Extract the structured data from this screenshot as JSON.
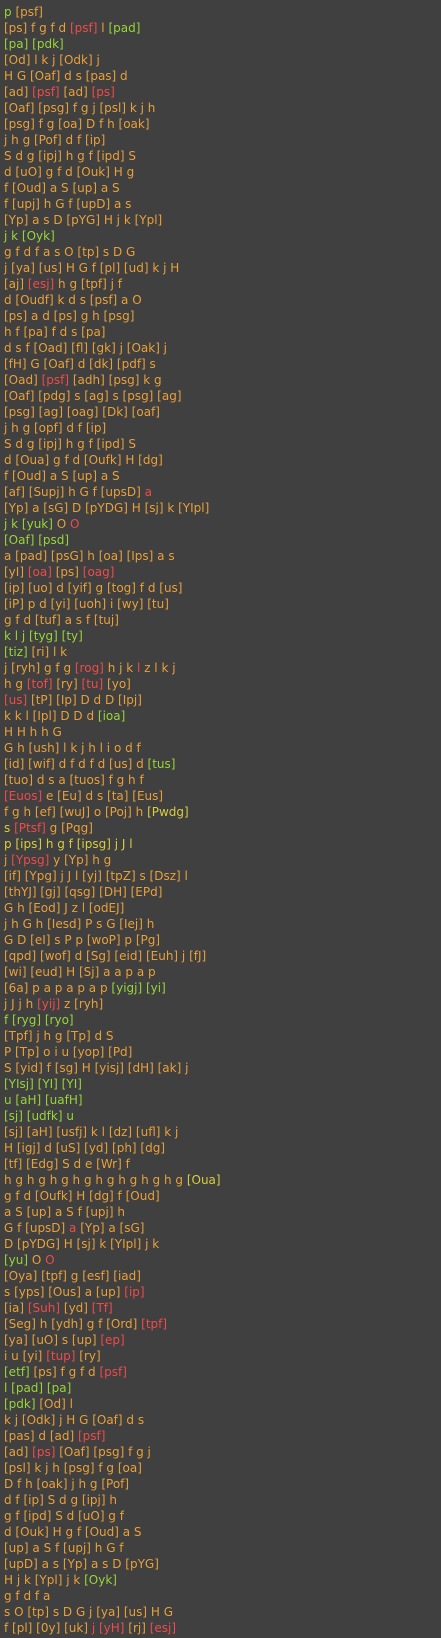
{
  "colors": {
    "background": "#404040",
    "orange": "#e8a03a",
    "green": "#98d43a",
    "red": "#ee4b4b",
    "yellow": "#d8cd3f"
  },
  "lines": [
    [
      [
        "G",
        "p "
      ],
      [
        "O",
        "[psf]"
      ]
    ],
    [
      [
        "O",
        "[ps] f g f d "
      ],
      [
        "R",
        "[psf]"
      ],
      [
        "O",
        " l "
      ],
      [
        "G",
        "[pad]"
      ]
    ],
    [
      [
        "G",
        "[pa] [pdk]"
      ]
    ],
    [
      [
        "O",
        "[Od] l k j [Odk] j"
      ]
    ],
    [
      [
        "O",
        "H G [Oaf] d s [pas] d"
      ]
    ],
    [
      [
        "O",
        "[ad] "
      ],
      [
        "R",
        "[psf]"
      ],
      [
        "O",
        " [ad] "
      ],
      [
        "R",
        "[ps]"
      ]
    ],
    [
      [
        "O",
        "[Oaf] [psg] f g j [psl] k j h"
      ]
    ],
    [
      [
        "O",
        "[psg] f g [oa] D f h [oak]"
      ]
    ],
    [
      [
        "O",
        "j h g [Pof] d f [ip]"
      ]
    ],
    [
      [
        "O",
        "S d g [ipj] h g f [ipd] S"
      ]
    ],
    [
      [
        "O",
        "d [uO] g f d [Ouk] H g"
      ]
    ],
    [
      [
        "O",
        "f [Oud] a S [up] a S"
      ]
    ],
    [
      [
        "O",
        "f [upj] h G f [upD] a s"
      ]
    ],
    [
      [
        "O",
        "[Yp] a s D [pYG] H j k [Ypl]"
      ]
    ],
    [
      [
        "G",
        "j k [Oyk]"
      ]
    ],
    [
      [
        "O",
        "g f d f a s O [tp] s D G"
      ]
    ],
    [
      [
        "O",
        "j [ya] [us] H G f [pl] [ud] k j H"
      ]
    ],
    [
      [
        "O",
        "[aj] "
      ],
      [
        "R",
        "[esj]"
      ],
      [
        "O",
        " h g [tpf] j f"
      ]
    ],
    [
      [
        "O",
        "d [Oudf] k d s [psf] a O"
      ]
    ],
    [
      [
        "O",
        "[ps] a d [ps] g h [psg]"
      ]
    ],
    [
      [
        "O",
        "h f [pa] f d s [pa]"
      ]
    ],
    [
      [
        "O",
        "d s f [Oad] [fl] [gk] j [Oak] j"
      ]
    ],
    [
      [
        "O",
        "[fH] G [Oaf] d [dk] [pdf] s"
      ]
    ],
    [
      [
        "O",
        "[Oad] "
      ],
      [
        "R",
        "[psf]"
      ],
      [
        "O",
        " [adh] [psg] k g"
      ]
    ],
    [
      [
        "O",
        "[Oaf] [pdg] s [ag] s [psg] [ag]"
      ]
    ],
    [
      [
        "O",
        "[psg] [ag] [oag] [Dk] [oaf]"
      ]
    ],
    [
      [
        "O",
        "j h g [opf] d f [ip]"
      ]
    ],
    [
      [
        "O",
        "S d g [ipj] h g f [ipd] S"
      ]
    ],
    [
      [
        "O",
        "d [Oua] g f d [Oufk] H [dg]"
      ]
    ],
    [
      [
        "O",
        "f [Oud] a S [up] a S"
      ]
    ],
    [
      [
        "O",
        "[af] [Supj] h G f [upsD] "
      ],
      [
        "R",
        "a"
      ]
    ],
    [
      [
        "O",
        "[Yp] a [sG] D [pYDG] H [sj] k [YIpl]"
      ]
    ],
    [
      [
        "G",
        "j k [yuk] "
      ],
      [
        "O",
        "O "
      ],
      [
        "R",
        "O"
      ]
    ],
    [
      [
        "G",
        "[Oaf] [psd]"
      ]
    ],
    [
      [
        "O",
        "a [pad] [psG] h [oa] [Ips] a s"
      ]
    ],
    [
      [
        "O",
        "[yI] "
      ],
      [
        "R",
        "[oa]"
      ],
      [
        "O",
        " [ps] "
      ],
      [
        "R",
        "[oag]"
      ]
    ],
    [
      [
        "O",
        "[ip] [uo] d [yif] g [tog] f d [us]"
      ]
    ],
    [
      [
        "O",
        "[iP] p d [yi] [uoh] i [wy] [tu]"
      ]
    ],
    [
      [
        "O",
        "g f d [tuf] a s f [tuj]"
      ]
    ],
    [
      [
        "G",
        "k l j [tyg] [ty]"
      ]
    ],
    [
      [
        "G",
        "[tiz] "
      ],
      [
        "O",
        "[ri] l k"
      ]
    ],
    [
      [
        "O",
        "j [ryh] g f g "
      ],
      [
        "R",
        "[rog]"
      ],
      [
        "O",
        " h j k "
      ],
      [
        "R",
        "l"
      ],
      [
        "O",
        " z l k j"
      ]
    ],
    [
      [
        "O",
        "h g "
      ],
      [
        "R",
        "[tof]"
      ],
      [
        "O",
        " [ry] "
      ],
      [
        "R",
        "[tu]"
      ],
      [
        "O",
        " [yo]"
      ]
    ],
    [
      [
        "R",
        "[us]"
      ],
      [
        "O",
        " [tP] [Ip] D d D [Ipj]"
      ]
    ],
    [
      [
        "O",
        "k k l [Ipl] D D d "
      ],
      [
        "G",
        "[ioa]"
      ]
    ],
    [
      [
        "O",
        "H H h h G"
      ]
    ],
    [
      [
        "O",
        "G h [ush] l k j h l i o d f"
      ]
    ],
    [
      [
        "O",
        "[id] [wif] d f d f d [us] d "
      ],
      [
        "G",
        "[tus]"
      ]
    ],
    [
      [
        "O",
        "[tuo] d s a [tuos] f g h f"
      ]
    ],
    [
      [
        "R",
        "[Euos]"
      ],
      [
        "O",
        " e [Eu] d s [ta] [Eus]"
      ]
    ],
    [
      [
        "O",
        "f g h [ef] [wuJ] o [Poj] h "
      ],
      [
        "Y",
        "[Pwdg]"
      ]
    ],
    [
      [
        "Y",
        "s "
      ],
      [
        "R",
        "[Ptsf]"
      ],
      [
        "O",
        " g [Pqg]"
      ]
    ],
    [
      [
        "Y",
        "p [ips] h g f [ipsg] j J l"
      ]
    ],
    [
      [
        "O",
        "j "
      ],
      [
        "R",
        "[Ypsg]"
      ],
      [
        "O",
        " y [Yp] h g"
      ]
    ],
    [
      [
        "O",
        "[if] [Ypg] j J l [yj] [tpZ] s [Dsz] l"
      ]
    ],
    [
      [
        "O",
        "[thYJ] [gj] [qsg] [DH] [EPd]"
      ]
    ],
    [
      [
        "O",
        "G h [Eod] J z l [odEJ]"
      ]
    ],
    [
      [
        "O",
        "j h G h [Iesd] P s G [Iej] h"
      ]
    ],
    [
      [
        "O",
        "G D [eI] s P p [woP] p [Pg]"
      ]
    ],
    [
      [
        "O",
        "[qpd] [wof] d [Sg] [eid] [Euh] j [fJ]"
      ]
    ],
    [
      [
        "O",
        "[wi] [eud] H [Sj] a a p a p"
      ]
    ],
    [
      [
        "O",
        "[6a] p a p a p a p "
      ],
      [
        "G",
        "[yigj] [yi]"
      ]
    ],
    [
      [
        "O",
        "j J j h "
      ],
      [
        "R",
        "[yij]"
      ],
      [
        "O",
        " z [ryh]"
      ]
    ],
    [
      [
        "G",
        "f [ryg] [ryo]"
      ]
    ],
    [
      [
        "O",
        "[Tpf] j h g [Tp] d S"
      ]
    ],
    [
      [
        "O",
        "P [Tp] o i u [yop] [Pd]"
      ]
    ],
    [
      [
        "O",
        "S [yid] f [sg] H [yisj] [dH] [ak] j"
      ]
    ],
    [
      [
        "G",
        "[YIsj] [YI] [YI]"
      ]
    ],
    [
      [
        "G",
        "u [aH] [uafH]"
      ]
    ],
    [
      [
        "G",
        "[sj] [udfk] u"
      ]
    ],
    [
      [
        "O",
        "[sj] [aH] [usfj] k l [dz] [ufl] k j"
      ]
    ],
    [
      [
        "O",
        "H [igj] d [uS] [yd] [ph] [dg]"
      ]
    ],
    [
      [
        "O",
        "[tf] [Edg] S d e [Wr] f"
      ]
    ],
    [
      [
        "O",
        "h g h g h g h g h g h g h g h g "
      ],
      [
        "Y",
        "[Oua]"
      ]
    ],
    [
      [
        "O",
        "g f d [Oufk] H [dg] f [Oud]"
      ]
    ],
    [
      [
        "O",
        "a S [up] a S f [upj] h"
      ]
    ],
    [
      [
        "O",
        "G f [upsD] "
      ],
      [
        "R",
        "a"
      ],
      [
        "O",
        " [Yp] a [sG]"
      ]
    ],
    [
      [
        "O",
        "D [pYDG] H [sj] k [YIpl] j k"
      ]
    ],
    [
      [
        "G",
        "[yu] "
      ],
      [
        "O",
        "O "
      ],
      [
        "R",
        "O"
      ]
    ],
    [
      [
        "O",
        "[Oya] [tpf] g [esf] [iad]"
      ]
    ],
    [
      [
        "O",
        "s [yps] [Ous] a [up] "
      ],
      [
        "R",
        "[ip]"
      ]
    ],
    [
      [
        "O",
        "[ia] "
      ],
      [
        "R",
        "[Suh]"
      ],
      [
        "O",
        " [yd] "
      ],
      [
        "R",
        "[Tf]"
      ]
    ],
    [
      [
        "O",
        "[Seg] h [ydh] g f [Ord] "
      ],
      [
        "R",
        "[tpf]"
      ]
    ],
    [
      [
        "O",
        "[ya] [uO] s [up] "
      ],
      [
        "R",
        "[ep]"
      ]
    ],
    [
      [
        "O",
        "i u [yi] "
      ],
      [
        "R",
        "[tup]"
      ],
      [
        "O",
        " [ry]"
      ]
    ],
    [
      [
        "G",
        "[etf] "
      ],
      [
        "O",
        "[ps] f g f d "
      ],
      [
        "R",
        "[psf]"
      ]
    ],
    [
      [
        "G",
        "l [pad] [pa]"
      ]
    ],
    [
      [
        "G",
        "[pdk] "
      ],
      [
        "O",
        "[Od] l"
      ]
    ],
    [
      [
        "O",
        "k j [Odk] j H G [Oaf] d s"
      ]
    ],
    [
      [
        "O",
        "[pas] d [ad] "
      ],
      [
        "R",
        "[psf]"
      ]
    ],
    [
      [
        "O",
        "[ad] "
      ],
      [
        "R",
        "[ps]"
      ],
      [
        "O",
        " [Oaf] [psg] f g j"
      ]
    ],
    [
      [
        "O",
        "[psl] k j h [psg] f g [oa]"
      ]
    ],
    [
      [
        "O",
        "D f h [oak] j h g [Pof]"
      ]
    ],
    [
      [
        "O",
        "d f [ip] S d g [ipj] h"
      ]
    ],
    [
      [
        "O",
        "g f [ipd] S d [uO] g f"
      ]
    ],
    [
      [
        "O",
        "d [Ouk] H g f [Oud] a S"
      ]
    ],
    [
      [
        "O",
        "[up] a S f [upj] h G f"
      ]
    ],
    [
      [
        "O",
        "[upD] a s [Yp] a s D [pYG]"
      ]
    ],
    [
      [
        "O",
        "H j k [Ypl] j k "
      ],
      [
        "G",
        "[Oyk]"
      ]
    ],
    [
      [
        "O",
        "g f d f a"
      ]
    ],
    [
      [
        "O",
        "s O [tp] s D G j [ya] [us] H G"
      ]
    ],
    [
      [
        "O",
        "f [pl] [0y] [uk] "
      ],
      [
        "R",
        "j [yH]"
      ],
      [
        "O",
        " [rj] "
      ],
      [
        "R",
        "[esj]"
      ]
    ]
  ]
}
